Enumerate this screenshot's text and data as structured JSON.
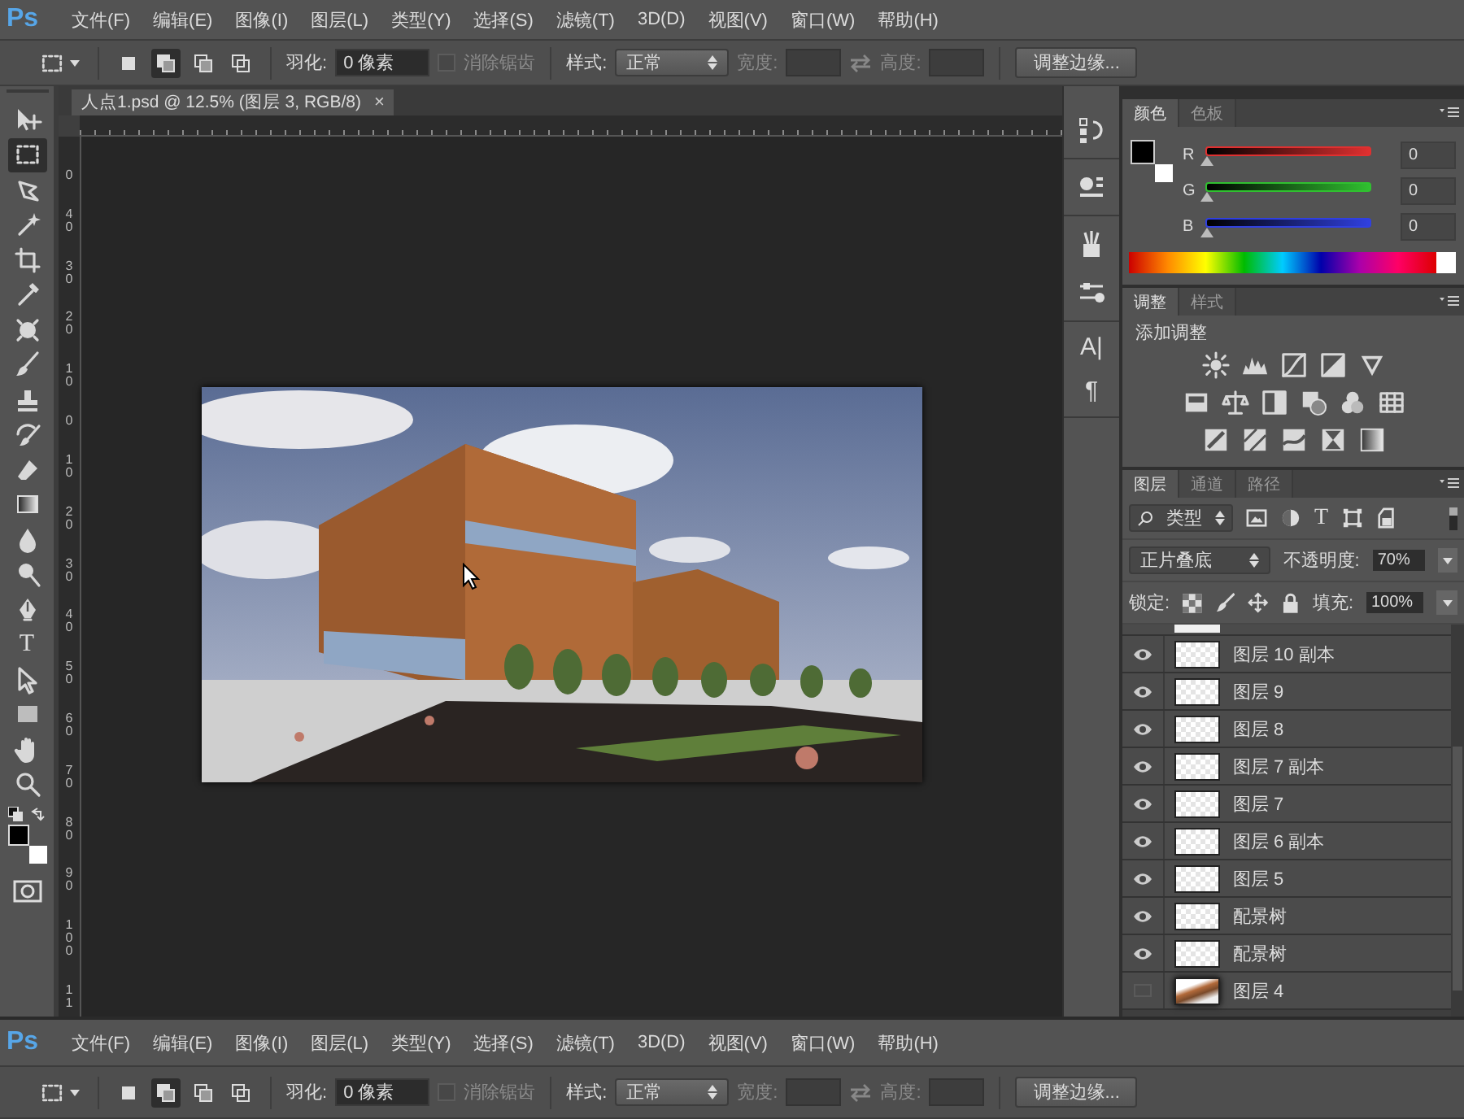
{
  "menubar": {
    "logo": "Ps",
    "items": [
      "文件(F)",
      "编辑(E)",
      "图像(I)",
      "图层(L)",
      "类型(Y)",
      "选择(S)",
      "滤镜(T)",
      "3D(D)",
      "视图(V)",
      "窗口(W)",
      "帮助(H)"
    ]
  },
  "options_bar": {
    "modes": [
      {
        "selected": false
      },
      {
        "selected": true
      },
      {
        "selected": false
      },
      {
        "selected": false
      }
    ],
    "feather_label": "羽化:",
    "feather_value": "0 像素",
    "antialias": {
      "label": "消除锯齿",
      "checked": false,
      "disabled": true
    },
    "style_label": "样式:",
    "style_value": "正常",
    "width_label": "宽度:",
    "height_label": "高度:",
    "refine_button": "调整边缘..."
  },
  "tools": [
    {
      "kind": "move",
      "selected": false
    },
    {
      "kind": "marquee",
      "selected": true
    },
    {
      "kind": "lasso",
      "selected": false
    },
    {
      "kind": "wand",
      "selected": false
    },
    {
      "kind": "crop",
      "selected": false
    },
    {
      "kind": "eyedropper",
      "selected": false
    },
    {
      "kind": "patch",
      "selected": false
    },
    {
      "kind": "brush",
      "selected": false
    },
    {
      "kind": "stamp",
      "selected": false
    },
    {
      "kind": "historybrush",
      "selected": false
    },
    {
      "kind": "eraser",
      "selected": false
    },
    {
      "kind": "gradient",
      "selected": false
    },
    {
      "kind": "drop",
      "selected": false
    },
    {
      "kind": "dodge",
      "selected": false
    },
    {
      "kind": "pen",
      "selected": false
    },
    {
      "kind": "type",
      "glyph": "T",
      "selected": false
    },
    {
      "kind": "pathselect",
      "selected": false
    },
    {
      "kind": "rectangle",
      "selected": false
    },
    {
      "kind": "hand",
      "selected": false
    },
    {
      "kind": "zoom",
      "selected": false
    }
  ],
  "document": {
    "tab_title": "人点1.psd @ 12.5% (图层 3, RGB/8)",
    "close": "×",
    "vertical_ruler": [
      "0",
      "40",
      "30",
      "20",
      "10",
      "0",
      "10",
      "20",
      "30",
      "40",
      "50",
      "60",
      "70",
      "80",
      "90",
      "100",
      "11"
    ]
  },
  "side_dock": {
    "character_glyph": "A|",
    "paragraph_glyph": "¶"
  },
  "color_panel": {
    "tabs": [
      {
        "label": "颜色",
        "selected": true
      },
      {
        "label": "色板",
        "selected": false
      }
    ],
    "channels": [
      {
        "label": "R",
        "color": "#e03030",
        "level": 0,
        "value": "0"
      },
      {
        "label": "G",
        "color": "#30c030",
        "level": 0,
        "value": "0"
      },
      {
        "label": "B",
        "color": "#3040e0",
        "level": 0,
        "value": "0"
      }
    ]
  },
  "adjustments_panel": {
    "tabs": [
      {
        "label": "调整",
        "selected": true
      },
      {
        "label": "样式",
        "selected": false
      }
    ],
    "title": "添加调整"
  },
  "layers_panel": {
    "tabs": [
      {
        "label": "图层",
        "selected": true
      },
      {
        "label": "通道",
        "selected": false
      },
      {
        "label": "路径",
        "selected": false
      }
    ],
    "filter_value": "类型",
    "filter_glyph": "T",
    "blend_mode": "正片叠底",
    "opacity_label": "不透明度:",
    "opacity_value": "70%",
    "lock_label": "锁定:",
    "fill_label": "填充:",
    "fill_value": "100%",
    "layers": [
      {
        "name": "图层 10 副本",
        "visible": true,
        "kind": "transparent"
      },
      {
        "name": "图层 9",
        "visible": true,
        "kind": "transparent"
      },
      {
        "name": "图层 8",
        "visible": true,
        "kind": "transparent"
      },
      {
        "name": "图层 7 副本",
        "visible": true,
        "kind": "transparent"
      },
      {
        "name": "图层 7",
        "visible": true,
        "kind": "transparent"
      },
      {
        "name": "图层 6 副本",
        "visible": true,
        "kind": "transparent"
      },
      {
        "name": "图层 5",
        "visible": true,
        "kind": "transparent"
      },
      {
        "name": "配景树",
        "visible": true,
        "kind": "transparent"
      },
      {
        "name": "配景树",
        "visible": true,
        "kind": "transparent"
      },
      {
        "name": "图层 4",
        "visible": false,
        "kind": "photo"
      }
    ]
  },
  "second_window": {
    "menubar": {
      "logo": "Ps",
      "items": [
        "文件(F)",
        "编辑(E)",
        "图像(I)",
        "图层(L)",
        "类型(Y)",
        "选择(S)",
        "滤镜(T)",
        "3D(D)",
        "视图(V)",
        "窗口(W)",
        "帮助(H)"
      ]
    },
    "options_bar": {
      "modes": [
        {
          "selected": false
        },
        {
          "selected": true
        },
        {
          "selected": false
        },
        {
          "selected": false
        }
      ],
      "feather_label": "羽化:",
      "feather_value": "0 像素",
      "antialias": {
        "label": "消除锯齿",
        "checked": false,
        "disabled": true
      },
      "style_label": "样式:",
      "style_value": "正常",
      "width_label": "宽度:",
      "height_label": "高度:",
      "refine_button": "调整边缘..."
    }
  }
}
